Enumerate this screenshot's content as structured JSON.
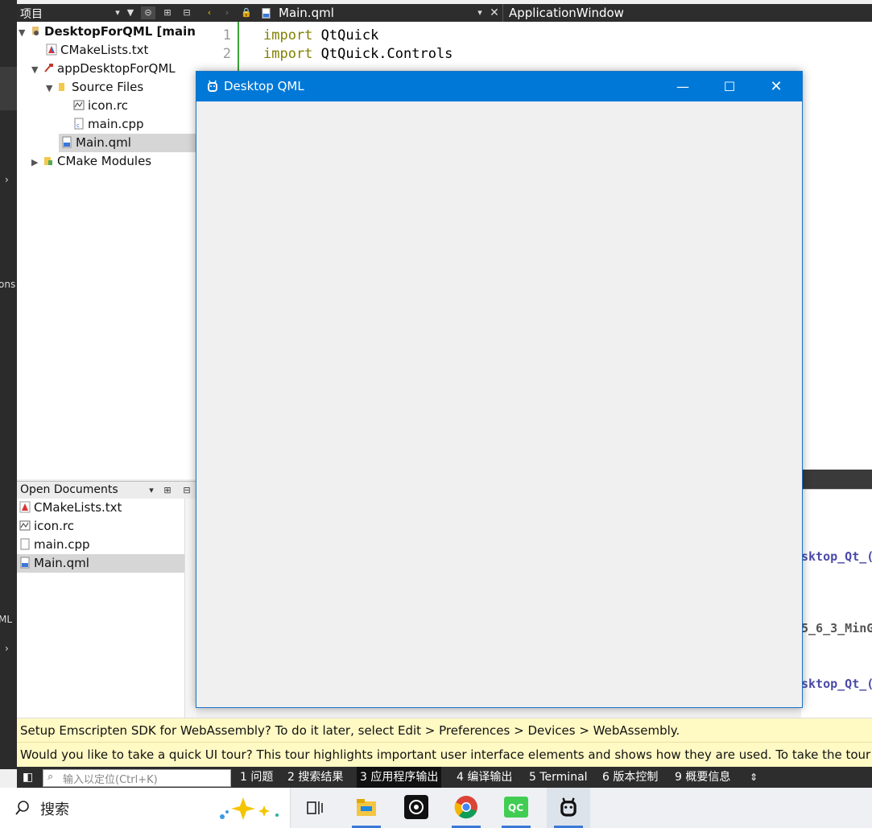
{
  "project_pane": {
    "title": "项目",
    "tree": [
      {
        "label": "DesktopForQML [main]"
      },
      {
        "label": "CMakeLists.txt"
      },
      {
        "label": "appDesktopForQML"
      },
      {
        "label": "Source Files"
      },
      {
        "label": "icon.rc"
      },
      {
        "label": "main.cpp"
      },
      {
        "label": "Main.qml"
      },
      {
        "label": "CMake Modules"
      }
    ]
  },
  "mode_bar": {
    "frag1": "ons",
    "frag2": "ML"
  },
  "open_documents": {
    "title": "Open Documents",
    "items": [
      {
        "label": "CMakeLists.txt"
      },
      {
        "label": "icon.rc"
      },
      {
        "label": "main.cpp"
      },
      {
        "label": "Main.qml"
      }
    ]
  },
  "editor": {
    "file_tab": "Main.qml",
    "symbol": "ApplicationWindow",
    "lines": [
      {
        "num": "1",
        "kw": "import",
        "text": " QtQuick"
      },
      {
        "num": "2",
        "kw": "import",
        "text": " QtQuick.Controls"
      }
    ]
  },
  "output_fragments": [
    "sktop_Qt_(",
    "5_6_3_MinG",
    "sktop_Qt_("
  ],
  "app_window": {
    "title": "Desktop QML"
  },
  "info_bars": {
    "emscripten": "Setup Emscripten SDK for WebAssembly? To do it later, select Edit > Preferences > Devices > WebAssembly.",
    "tour": "Would you like to take a quick UI tour? This tour highlights important user interface elements and shows how they are used. To take the tour later,"
  },
  "status_bar": {
    "locator_placeholder": "输入以定位(Ctrl+K)",
    "panes": [
      {
        "num": "1",
        "label": "问题"
      },
      {
        "num": "2",
        "label": "搜索结果"
      },
      {
        "num": "3",
        "label": "应用程序输出"
      },
      {
        "num": "4",
        "label": "编译输出"
      },
      {
        "num": "5",
        "label": "Terminal"
      },
      {
        "num": "6",
        "label": "版本控制"
      },
      {
        "num": "9",
        "label": "概要信息"
      }
    ]
  },
  "taskbar": {
    "search_label": "搜索",
    "apps": [
      "task-view",
      "file-explorer",
      "chatgpt",
      "chrome",
      "qt-creator",
      "desktop-qml-app"
    ]
  },
  "colors": {
    "title_blue": "#0078d7",
    "info_yellow": "#fff9c4",
    "dark_bar": "#2d2d2d"
  }
}
